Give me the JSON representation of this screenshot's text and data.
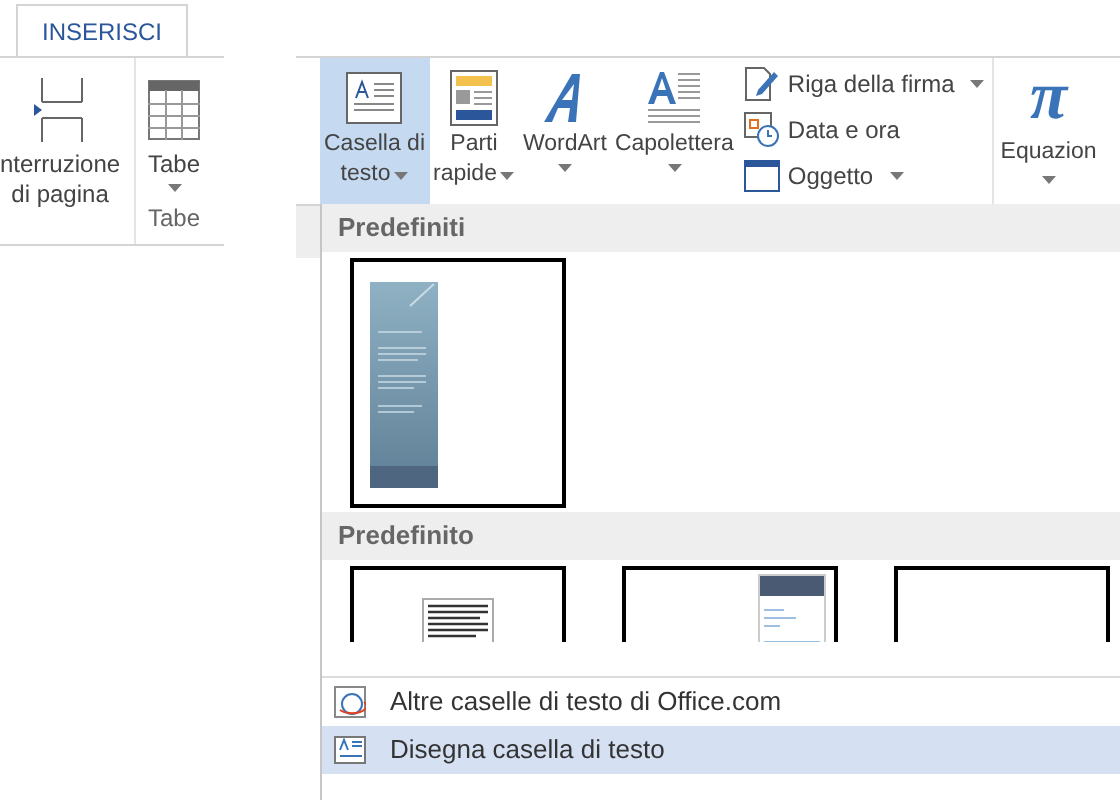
{
  "tab": {
    "label": "INSERISCI",
    "selected": true
  },
  "left_ribbon": {
    "buttons": [
      {
        "lines": [
          "nterruzione",
          "di pagina"
        ],
        "kind": "break",
        "dropdown": false
      },
      {
        "lines": [
          "Tabe"
        ],
        "kind": "table",
        "dropdown": true
      }
    ],
    "group_label": "Tabe"
  },
  "ribbon": {
    "large_buttons": [
      {
        "lines": [
          "Casella di",
          "testo"
        ],
        "kind": "textbox",
        "selected": true,
        "dropdown": true
      },
      {
        "lines": [
          "Parti",
          "rapide"
        ],
        "kind": "parts",
        "selected": false,
        "dropdown": true
      },
      {
        "lines": [
          "WordArt"
        ],
        "kind": "wordart",
        "selected": false,
        "dropdown": true
      },
      {
        "lines": [
          "Capolettera"
        ],
        "kind": "dropcap",
        "selected": false,
        "dropdown": true
      }
    ],
    "small_buttons": [
      {
        "label": "Riga della firma",
        "kind": "signature",
        "dropdown": true
      },
      {
        "label": "Data e ora",
        "kind": "date",
        "dropdown": false
      },
      {
        "label": "Oggetto",
        "kind": "object",
        "dropdown": true
      }
    ],
    "equation": {
      "label": "Equazion",
      "glyph": "π"
    }
  },
  "gallery": {
    "sections": [
      {
        "title": "Predefiniti",
        "thumbnails": [
          {
            "kind": "sidebar"
          }
        ]
      },
      {
        "title": "Predefinito",
        "thumbnails": [
          {
            "kind": "text"
          },
          {
            "kind": "quote"
          },
          {
            "kind": "blank"
          }
        ]
      }
    ]
  },
  "menu_items": [
    {
      "label": "Altre caselle di testo di Office.com",
      "kind": "online",
      "selected": false
    },
    {
      "label": "Disegna casella di testo",
      "kind": "draw",
      "selected": true
    }
  ]
}
